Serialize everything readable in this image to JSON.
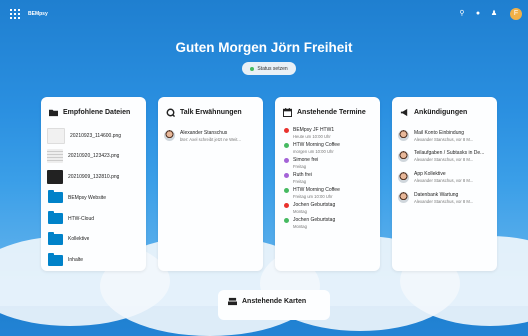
{
  "topbar": {
    "logo": "BEMpsy"
  },
  "user": {
    "initial": "F"
  },
  "greeting": "Guten Morgen Jörn Freiheit",
  "status_button": "Status setzen",
  "panels": {
    "files": {
      "title": "Empfohlene Dateien",
      "items": [
        {
          "name": "20210923_114600.png",
          "type": "image"
        },
        {
          "name": "20210920_123423.png",
          "type": "image"
        },
        {
          "name": "20210909_132810.png",
          "type": "image"
        },
        {
          "name": "BEMpsy Website",
          "type": "folder"
        },
        {
          "name": "HTW-Cloud",
          "type": "folder"
        },
        {
          "name": "Kollektive",
          "type": "folder"
        },
        {
          "name": "Inhalte",
          "type": "folder"
        }
      ]
    },
    "talk": {
      "title": "Talk Erwähnungen",
      "items": [
        {
          "name": "Alexander Stanschus",
          "sub": "bter: Axel schreibt jetzt ne Weit..."
        }
      ]
    },
    "events": {
      "title": "Anstehende Termine",
      "items": [
        {
          "title": "BEMpsy JF HTW1",
          "sub": "Heute um 10:00 Uhr",
          "color": "#e9322d"
        },
        {
          "title": "HTW Morning Coffee",
          "sub": "morgen um 10:00 Uhr",
          "color": "#46ba61"
        },
        {
          "title": "Simone frei",
          "sub": "Freitag",
          "color": "#a463d7"
        },
        {
          "title": "Ruth frei",
          "sub": "Freitag",
          "color": "#a463d7"
        },
        {
          "title": "HTW Morning Coffee",
          "sub": "Freitag um 10:00 Uhr",
          "color": "#46ba61"
        },
        {
          "title": "Jochen Geburtstag",
          "sub": "Montag",
          "color": "#e9322d"
        },
        {
          "title": "Jochen Geburtstag",
          "sub": "Montag",
          "color": "#46ba61"
        }
      ]
    },
    "announcements": {
      "title": "Ankündigungen",
      "items": [
        {
          "title": "Mail Konto Einbindung",
          "sub": "Alexander Stanschus, vor 8 M..."
        },
        {
          "title": "Teilaufgaben / Subtasks in De...",
          "sub": "Alexander Stanschus, vor 8 M..."
        },
        {
          "title": "App Kollektive",
          "sub": "Alexander Stanschus, vor 8 M..."
        },
        {
          "title": "Datenbank Wartung",
          "sub": "Alexander Stanschus, vor 8 M..."
        }
      ]
    }
  },
  "bottom_card": {
    "title": "Anstehende Karten"
  },
  "colors": {
    "accent": "#0082c9",
    "status_dot": "#46ba61"
  }
}
